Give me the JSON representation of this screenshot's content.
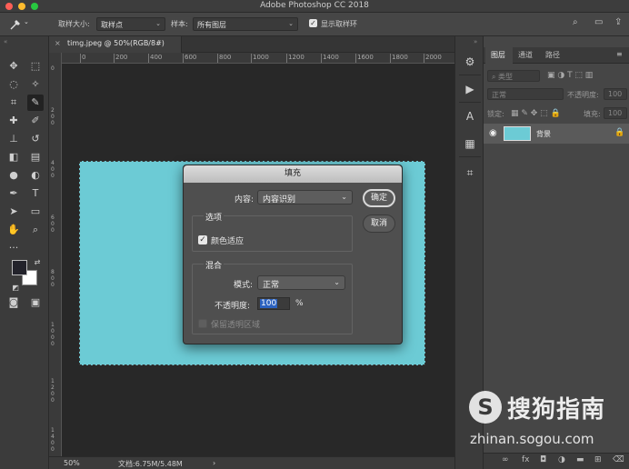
{
  "app": {
    "title": "Adobe Photoshop CC 2018"
  },
  "options_bar": {
    "sample_size_label": "取样大小:",
    "sample_size_value": "取样点",
    "sample_label": "样本:",
    "sample_value": "所有图层",
    "show_ring_label": "显示取样环"
  },
  "document": {
    "tab_label": "timg.jpeg @ 50%(RGB/8#)",
    "close_glyph": "×",
    "canvas_color": "#6ccbd5"
  },
  "ruler": {
    "top_ticks": [
      "0",
      "200",
      "400",
      "600",
      "800",
      "1000",
      "1200",
      "1400",
      "1600",
      "1800",
      "2000"
    ],
    "left_ticks": [
      "0",
      "2\n0\n0",
      "4\n0\n0",
      "6\n0\n0",
      "8\n0\n0",
      "1\n0\n0\n0",
      "1\n2\n0\n0",
      "1\n4\n0\n0"
    ]
  },
  "status": {
    "zoom": "50%",
    "doc_size": "文档:6.75M/5.48M",
    "arrow": "›"
  },
  "layers_panel": {
    "tabs": [
      "图层",
      "通道",
      "路径"
    ],
    "filter_label": "类型",
    "blend_mode": "正常",
    "opacity_label": "不透明度:",
    "opacity_value": "100",
    "lock_label": "锁定:",
    "fill_label": "填充:",
    "fill_value": "100",
    "layer_name": "背景"
  },
  "fill_dialog": {
    "title": "填充",
    "content_label": "内容:",
    "content_value": "内容识别",
    "ok_label": "确定",
    "cancel_label": "取消",
    "options_title": "选项",
    "color_adapt_label": "颜色适应",
    "color_adapt_checked": true,
    "blend_title": "混合",
    "mode_label": "模式:",
    "mode_value": "正常",
    "opacity_label": "不透明度:",
    "opacity_value": "100",
    "opacity_unit": "%",
    "preserve_label": "保留透明区域",
    "preserve_enabled": false
  },
  "watermark": {
    "logo_letter": "S",
    "brand": "搜狗指南",
    "url": "zhinan.sogou.com"
  },
  "icons": {
    "eyedropper": "eyedropper-icon",
    "search": "search-icon",
    "eye": "eye-icon",
    "lock": "lock-icon"
  }
}
